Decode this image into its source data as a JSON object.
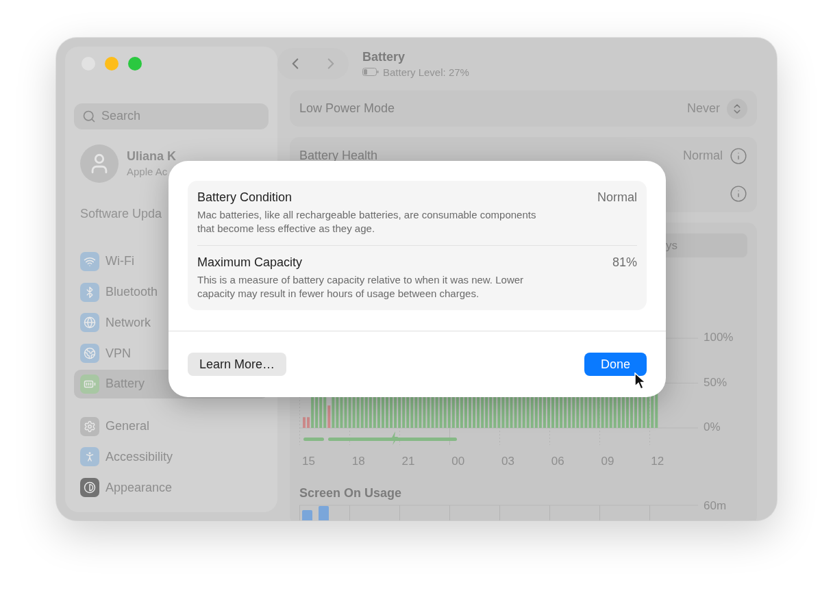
{
  "window": {
    "traffic_lights": [
      {
        "color": "#e2e2e2"
      },
      {
        "color": "#fdbd1a"
      },
      {
        "color": "#2bc840"
      }
    ]
  },
  "sidebar": {
    "search": {
      "placeholder": "Search"
    },
    "account": {
      "name": "Uliana K",
      "subtitle": "Apple Ac"
    },
    "update": "Software Upda",
    "items": [
      {
        "label": "Wi-Fi",
        "kind": "wifi",
        "color": "#a5bed6",
        "selected": false
      },
      {
        "label": "Bluetooth",
        "kind": "bluetooth",
        "color": "#a5bed6",
        "selected": false
      },
      {
        "label": "Network",
        "kind": "globe",
        "color": "#a5bed6",
        "selected": false
      },
      {
        "label": "VPN",
        "kind": "vpn",
        "color": "#a5bed6",
        "selected": false
      },
      {
        "label": "Battery",
        "kind": "battery",
        "color": "#a8c7a3",
        "selected": true
      },
      {
        "label": "General",
        "kind": "gear",
        "color": "#b9b9b9",
        "selected": false
      },
      {
        "label": "Accessibility",
        "kind": "person",
        "color": "#a5bed6",
        "selected": false
      },
      {
        "label": "Appearance",
        "kind": "contrast",
        "color": "#727272",
        "selected": false
      }
    ]
  },
  "header": {
    "title": "Battery",
    "subtitle": "Battery Level: 27%"
  },
  "low_power": {
    "label": "Low Power Mode",
    "value": "Never"
  },
  "health": {
    "label": "Battery Health",
    "value": "Normal"
  },
  "range": {
    "text": "ys"
  },
  "battery_chart": {
    "y_labels": [
      "100%",
      "50%",
      "0%"
    ],
    "x_labels": [
      "15",
      "18",
      "21",
      "00",
      "03",
      "06",
      "09",
      "12"
    ]
  },
  "screen_usage": {
    "title": "Screen On Usage",
    "y_label": "60m"
  },
  "dialog": {
    "rows": [
      {
        "title": "Battery Condition",
        "value": "Normal",
        "description": "Mac batteries, like all rechargeable batteries, are consumable components that become less effective as they age."
      },
      {
        "title": "Maximum Capacity",
        "value": "81%",
        "description": "This is a measure of battery capacity relative to when it was new. Lower capacity may result in fewer hours of usage between charges."
      }
    ],
    "buttons": [
      {
        "label": "Learn More…",
        "kind": "secondary"
      },
      {
        "label": "Done",
        "kind": "primary"
      }
    ]
  }
}
